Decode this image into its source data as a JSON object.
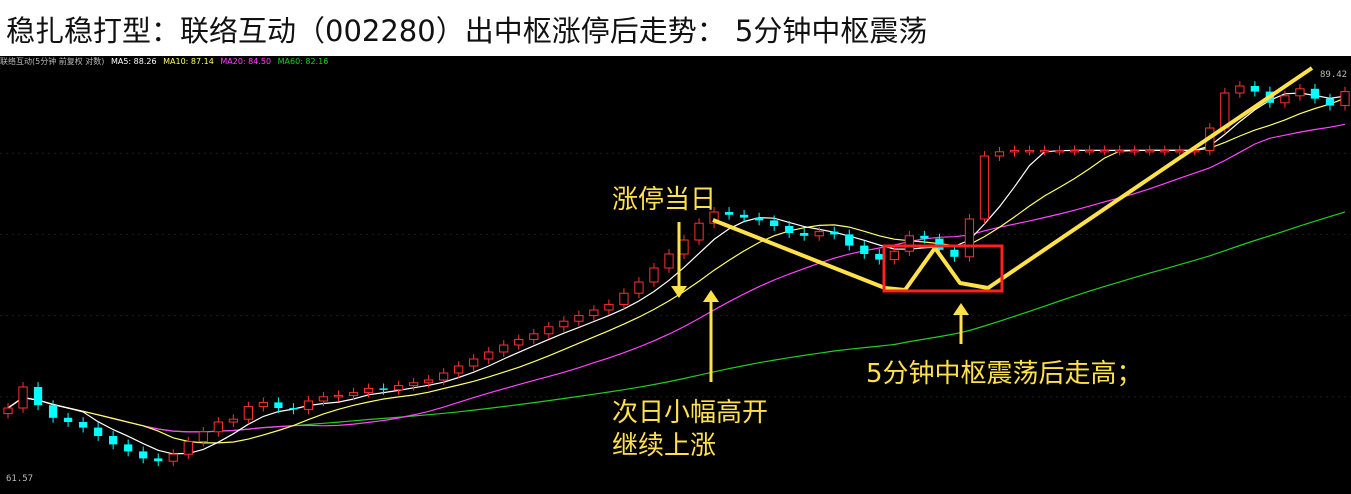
{
  "title": "稳扎稳打型：联络互动（002280）出中枢涨停后走势： 5分钟中枢震荡",
  "legend": {
    "security": "联络互动(5分钟 前复权 对数)",
    "ma5": "MA5: 88.26",
    "ma10": "MA10: 87.14",
    "ma20": "MA20: 84.50",
    "ma60": "MA60: 82.16"
  },
  "annotations": {
    "limit_up_day": "涨停当日",
    "next_day_line1": "次日小幅高开",
    "next_day_line2": "继续上涨",
    "oscillation": "5分钟中枢震荡后走高；"
  },
  "price_labels": {
    "high": "89.42",
    "low": "61.57"
  },
  "colors": {
    "background": "#000000",
    "up": "#ff3030",
    "down": "#00ffff",
    "ma5": "#ffffff",
    "ma10": "#ffff66",
    "ma20": "#ff44ff",
    "ma60": "#22cc22",
    "annotation": "#ffe14a",
    "box": "#ff2020"
  },
  "chart_data": {
    "type": "candlestick",
    "title": "稳扎稳打型：联络互动（002280）出中枢涨停后走势： 5分钟中枢震荡",
    "ylim": [
      61,
      90
    ],
    "close": [
      66,
      67.5,
      66.2,
      65.3,
      65.0,
      64.6,
      64.0,
      63.4,
      62.9,
      62.4,
      62.2,
      62.7,
      63.6,
      64.3,
      65.0,
      65.2,
      66.1,
      66.4,
      66.0,
      65.9,
      66.5,
      66.8,
      66.9,
      67.1,
      67.4,
      67.3,
      67.6,
      67.8,
      68.0,
      68.5,
      69.0,
      69.5,
      70.0,
      70.5,
      70.9,
      71.3,
      71.8,
      72.2,
      72.6,
      73.0,
      73.4,
      74.2,
      75.0,
      76.0,
      77.0,
      78.0,
      79.2,
      80.0,
      79.8,
      79.6,
      79.4,
      79.0,
      78.5,
      78.3,
      78.6,
      78.4,
      77.6,
      77.0,
      76.6,
      77.2,
      78.3,
      78.1,
      77.3,
      76.8,
      79.5,
      84.0,
      84.3,
      84.4,
      84.4,
      84.4,
      84.4,
      84.4,
      84.4,
      84.4,
      84.4,
      84.4,
      84.4,
      84.4,
      84.4,
      84.4,
      86.0,
      88.5,
      89.0,
      88.6,
      87.8,
      88.3,
      88.8,
      88.1,
      87.6,
      88.6
    ]
  }
}
